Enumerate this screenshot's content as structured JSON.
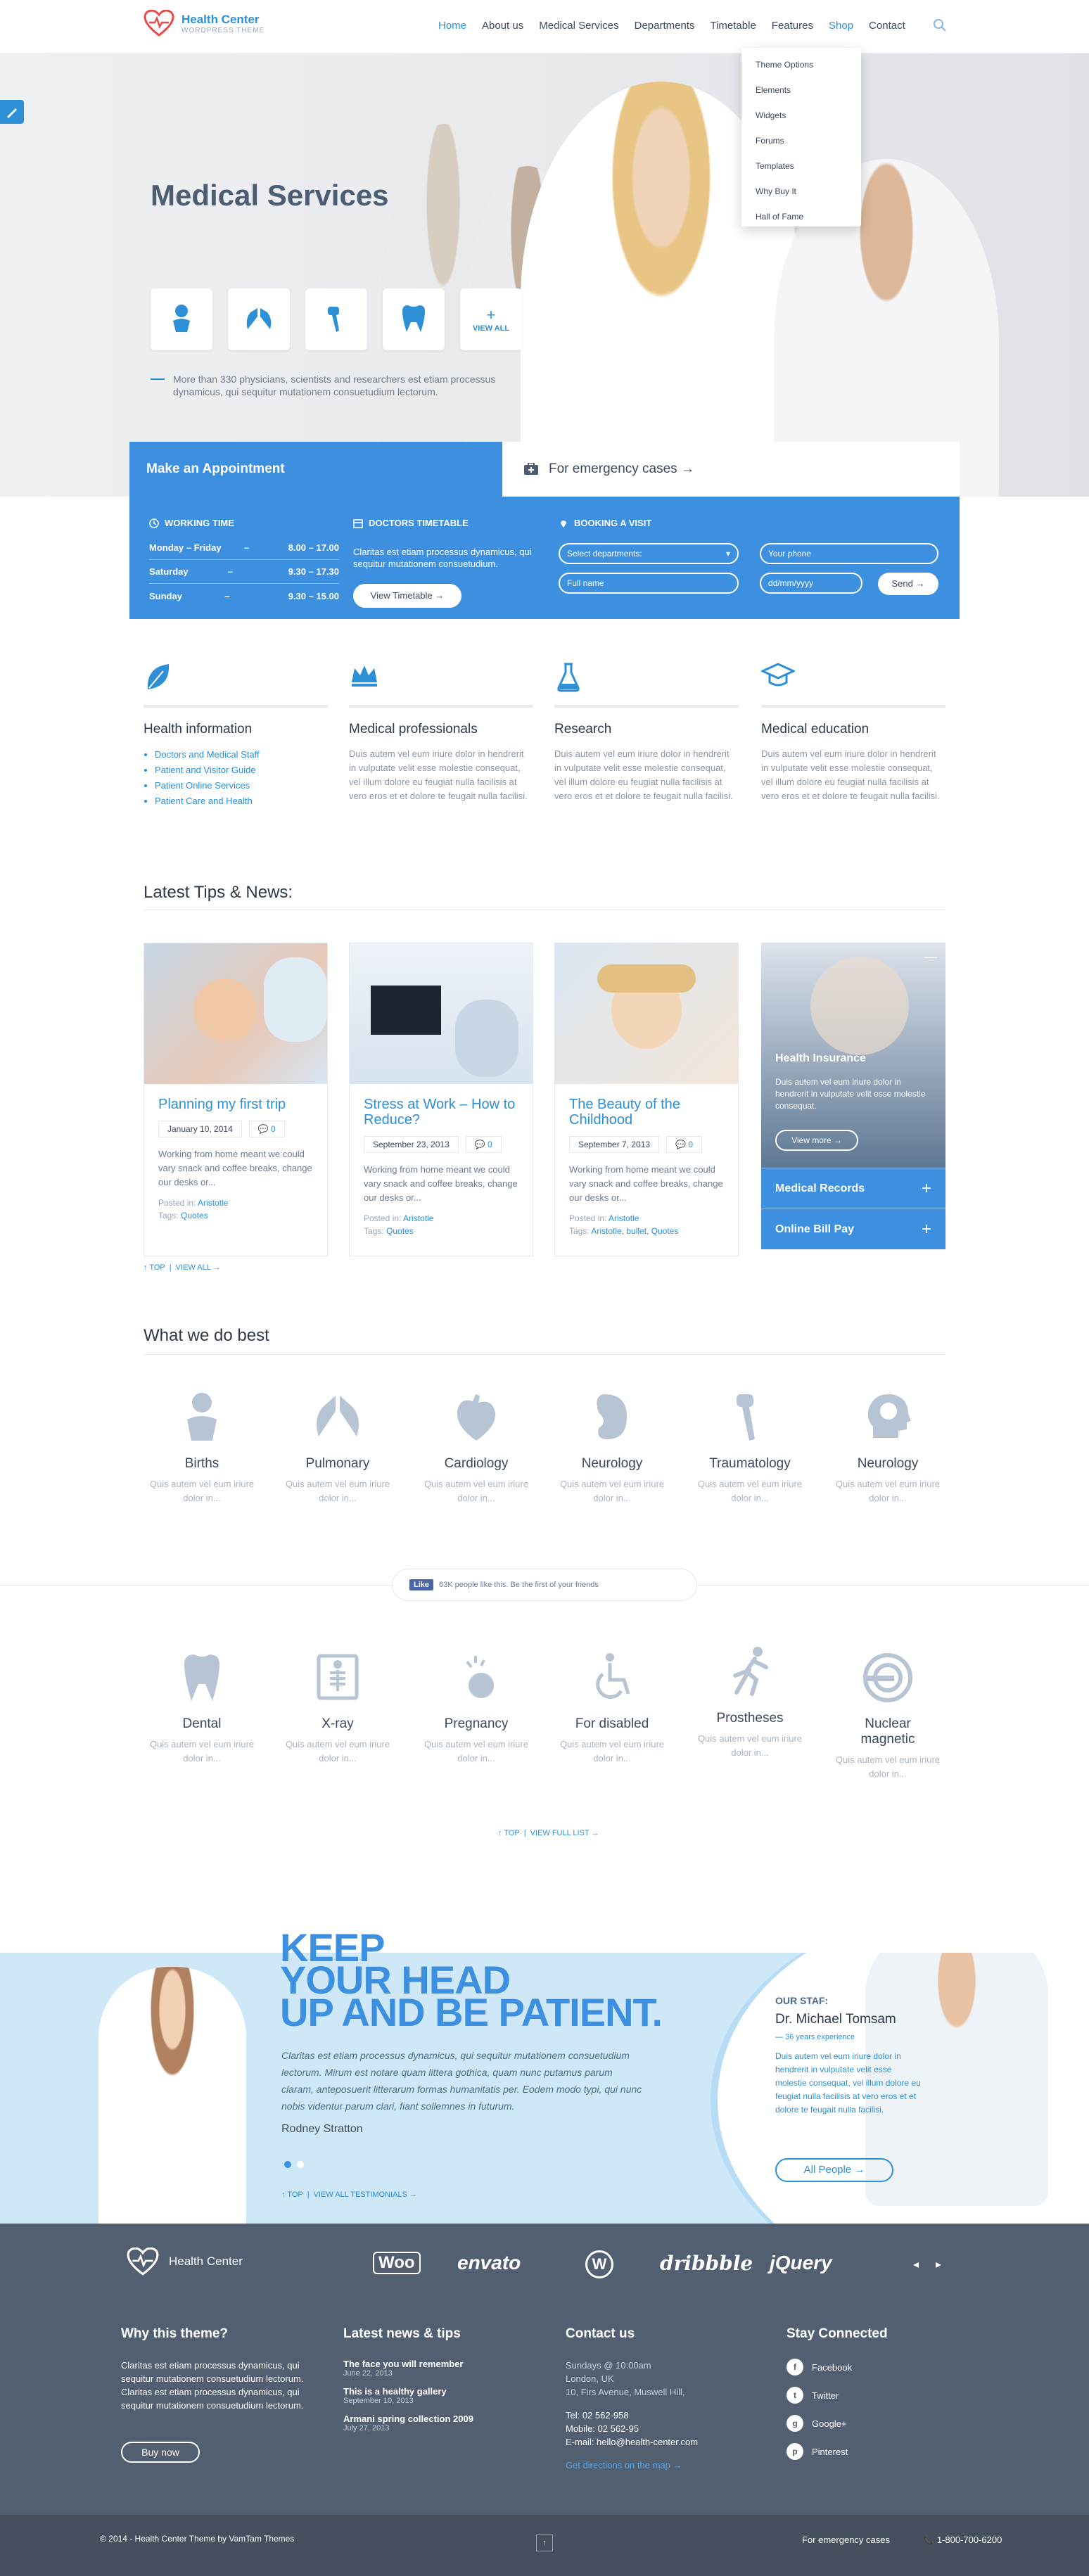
{
  "header": {
    "logo_title": "Health Center",
    "logo_sub": "WORDPRESS THEME",
    "nav": [
      "Home",
      "About us",
      "Medical Services",
      "Departments",
      "Timetable",
      "Features",
      "Shop",
      "Contact"
    ],
    "dropdown": [
      "Theme Options",
      "Elements",
      "Widgets",
      "Forums",
      "Templates",
      "Why Buy It",
      "Hall of Fame"
    ]
  },
  "hero": {
    "title": "Medical Services",
    "view_all": "VIEW ALL",
    "description": "More than 330 physicians, scientists and researchers est etiam processus dynamicus, qui sequitur mutationem consuetudium lectorum."
  },
  "appointment": {
    "title": "Make an Appointment",
    "emergency": "For emergency cases →",
    "working_time_label": "WORKING TIME",
    "hours": [
      {
        "day": "Monday – Friday",
        "dash": "–",
        "time": "8.00 – 17.00"
      },
      {
        "day": "Saturday",
        "dash": "–",
        "time": "9.30 – 17.30"
      },
      {
        "day": "Sunday",
        "dash": "–",
        "time": "9.30 – 15.00"
      }
    ],
    "doctors_label": "DOCTORS TIMETABLE",
    "doctors_text": "Claritas est etiam processus dynamicus, qui sequitur mutationem consuetudium.",
    "timetable_btn": "View Timetable →",
    "booking_label": "BOOKING A VISIT",
    "departments_placeholder": "Select departments:",
    "fullname_placeholder": "Full name",
    "phone_placeholder": "Your phone",
    "date_placeholder": "dd/mm/yyyy",
    "send_btn": "Send →"
  },
  "features": [
    {
      "title": "Health information",
      "links": [
        "Doctors and Medical Staff",
        "Patient and Visitor Guide",
        "Patient Online Services",
        "Patient Care and Health"
      ]
    },
    {
      "title": "Medical professionals",
      "text": "Duis autem vel eum iriure dolor in hendrerit in vulputate velit esse molestie consequat, vel illum dolore eu feugiat nulla facilisis at vero eros et et dolore te feugait nulla facilisi."
    },
    {
      "title": "Research",
      "text": "Duis autem vel eum iriure dolor in hendrerit in vulputate velit esse molestie consequat, vel illum dolore eu feugiat nulla facilisis at vero eros et et dolore te feugait nulla facilisi."
    },
    {
      "title": "Medical education",
      "text": "Duis autem vel eum iriure dolor in hendrerit in vulputate velit esse molestie consequat, vel illum dolore eu feugiat nulla facilisis at vero eros et et dolore te feugait nulla facilisi."
    }
  ],
  "news": {
    "title": "Latest Tips & News:",
    "cards": [
      {
        "title": "Planning my first trip",
        "date": "January 10, 2014",
        "comments": "0",
        "text": "Working from home meant we could vary snack and coffee breaks, change our desks or...",
        "posted_label": "Posted in:",
        "posted": "Aristotle",
        "tags_label": "Tags:",
        "tags": "Quotes"
      },
      {
        "title": "Stress at Work – How to Reduce?",
        "date": "September 23, 2013",
        "comments": "0",
        "text": "Working from home meant we could vary snack and coffee breaks, change our desks or...",
        "posted_label": "Posted in:",
        "posted": "Aristotle",
        "tags_label": "Tags:",
        "tags": "Quotes"
      },
      {
        "title": "The Beauty of the Childhood",
        "date": "September 7, 2013",
        "comments": "0",
        "text": "Working from home meant we could vary snack and coffee breaks, change our desks or...",
        "posted_label": "Posted in:",
        "posted": "Aristotle",
        "tags_label": "Tags:",
        "tags": "Aristotle, bullet, Quotes"
      }
    ],
    "side_title": "Health Insurance",
    "side_text": "Duis autem vel eum iriure dolor in hendrerit in vulputate velit esse molestie consequat.",
    "side_btn": "View more →",
    "side_rows": [
      "Medical Records",
      "Online Bill Pay"
    ],
    "top_link": "↑ TOP",
    "view_all": "VIEW ALL →"
  },
  "best": {
    "title": "What we do best",
    "items1": [
      {
        "name": "Births",
        "text": "Quis autem vel eum iriure dolor in..."
      },
      {
        "name": "Pulmonary",
        "text": "Quis autem vel eum iriure dolor in..."
      },
      {
        "name": "Cardiology",
        "text": "Quis autem vel eum iriure dolor in..."
      },
      {
        "name": "Neurology",
        "text": "Quis autem vel eum iriure dolor in..."
      },
      {
        "name": "Traumatology",
        "text": "Quis autem vel eum iriure dolor in..."
      },
      {
        "name": "Neurology",
        "text": "Quis autem vel eum iriure dolor in..."
      }
    ],
    "fb_like": "Like",
    "fb_text": "63K people like this. Be the first of your friends",
    "items2": [
      {
        "name": "Dental",
        "text": "Quis autem vel eum iriure dolor in..."
      },
      {
        "name": "X-ray",
        "text": "Quis autem vel eum iriure dolor in..."
      },
      {
        "name": "Pregnancy",
        "text": "Quis autem vel eum iriure dolor in..."
      },
      {
        "name": "For disabled",
        "text": "Quis autem vel eum iriure dolor in..."
      },
      {
        "name": "Prostheses",
        "text": "Quis autem vel eum iriure dolor in..."
      },
      {
        "name": "Nuclear magnetic",
        "text": "Quis autem vel eum iriure dolor in..."
      }
    ],
    "top_link": "↑ TOP",
    "view_full": "VIEW FULL LIST →"
  },
  "testimonial": {
    "headline1": "KEEP",
    "headline2": "YOUR HEAD",
    "headline3": "UP AND BE PATIENT.",
    "quote": "Claritas est etiam processus dynamicus, qui sequitur mutationem consuetudium lectorum. Mirum est notare quam littera gothica, quam nunc putamus parum claram, anteposuerit litterarum formas humanitatis per. Eodem modo typi, qui nunc nobis videntur parum clari, fiant sollemnes in futurum.",
    "author": "Rodney Stratton",
    "top_link": "↑ TOP",
    "view_all": "VIEW ALL TESTIMONIALS →",
    "staff_label": "OUR STAF:",
    "staff_name": "Dr. Michael Tomsam",
    "staff_exp": "36 years experience",
    "staff_text": "Duis autem vel eum iriure dolor in hendrerit in vulputate velit esse molestie consequat, vel illum dolore eu feugiat nulla facilisis at vero eros et et dolore te feugait nulla facilisi.",
    "all_people": "All People →"
  },
  "footer": {
    "logo": "Health Center",
    "brands": [
      "Woo",
      "envato",
      "W",
      "dribbble",
      "jQuery"
    ],
    "why_title": "Why this theme?",
    "why_text": "Claritas est etiam processus dynamicus, qui sequitur mutationem consuetudium lectorum. Claritas est etiam processus dynamicus, qui sequitur mutationem consuetudium lectorum.",
    "buy_now": "Buy now",
    "news_title": "Latest news & tips",
    "news": [
      {
        "title": "The face you will remember",
        "date": "June 22, 2013"
      },
      {
        "title": "This is a healthy gallery",
        "date": "September 10, 2013"
      },
      {
        "title": "Armani spring collection 2009",
        "date": "July 27, 2013"
      }
    ],
    "contact_title": "Contact us",
    "contact_lines": [
      "Sundays @ 10:00am",
      "London, UK",
      "10, Firs Avenue, Muswell Hill,"
    ],
    "tel": "Tel: 02 562-958",
    "mobile": "Mobile: 02 562-95",
    "email": "E-mail: hello@health-center.com",
    "directions": "Get directions on the map →",
    "stay_title": "Stay Connected",
    "social": [
      "Facebook",
      "Twitter",
      "Google+",
      "Pinterest"
    ],
    "copyright": "© 2014 - Health Center Theme by VamTam Themes",
    "emergency": "For emergency cases",
    "phone": "1-800-700-6200"
  }
}
